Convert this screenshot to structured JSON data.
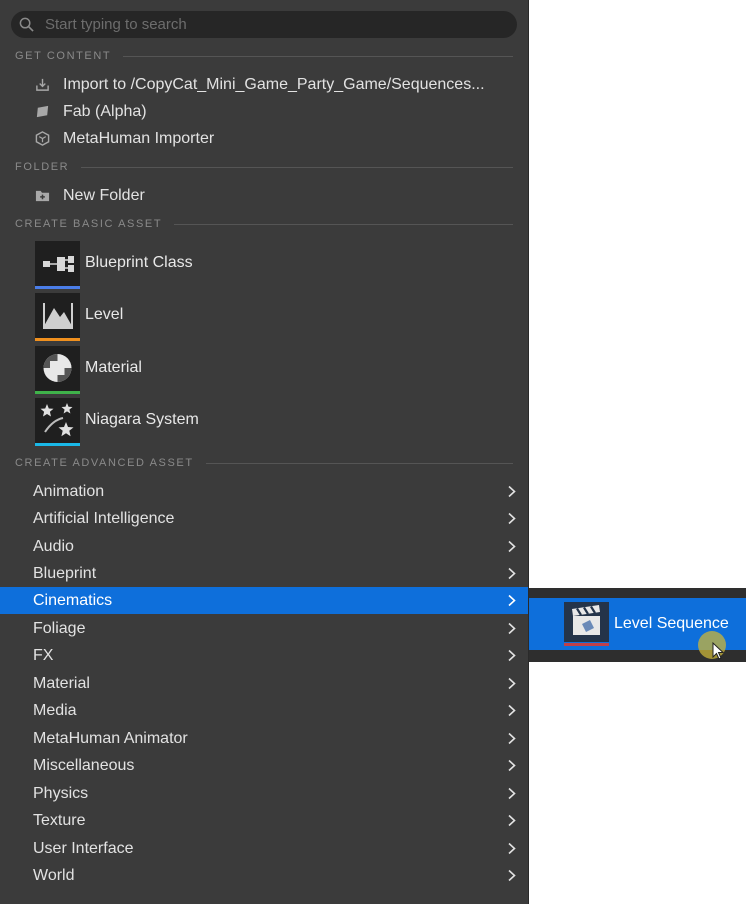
{
  "search": {
    "placeholder": "Start typing to search",
    "icon": "search-icon"
  },
  "get_content": {
    "header": "GET CONTENT",
    "items": [
      {
        "label": "Import to /CopyCat_Mini_Game_Party_Game/Sequences...",
        "icon": "import-icon"
      },
      {
        "label": "Fab (Alpha)",
        "icon": "fab-icon"
      },
      {
        "label": "MetaHuman Importer",
        "icon": "metahuman-icon"
      }
    ]
  },
  "folder": {
    "header": "FOLDER",
    "items": [
      {
        "label": "New Folder",
        "icon": "new-folder-icon"
      }
    ]
  },
  "basic_assets": {
    "header": "CREATE BASIC ASSET",
    "items": [
      {
        "label": "Blueprint Class",
        "icon": "blueprint-class-icon",
        "color": "#4a7de8"
      },
      {
        "label": "Level",
        "icon": "level-icon",
        "color": "#f0901e"
      },
      {
        "label": "Material",
        "icon": "material-icon",
        "color": "#3fb24a"
      },
      {
        "label": "Niagara System",
        "icon": "niagara-system-icon",
        "color": "#1ab8e8"
      }
    ]
  },
  "advanced_assets": {
    "header": "CREATE ADVANCED ASSET",
    "items": [
      {
        "label": "Animation"
      },
      {
        "label": "Artificial Intelligence"
      },
      {
        "label": "Audio"
      },
      {
        "label": "Blueprint"
      },
      {
        "label": "Cinematics",
        "selected": true
      },
      {
        "label": "Foliage"
      },
      {
        "label": "FX"
      },
      {
        "label": "Material"
      },
      {
        "label": "Media"
      },
      {
        "label": "MetaHuman Animator"
      },
      {
        "label": "Miscellaneous"
      },
      {
        "label": "Physics"
      },
      {
        "label": "Texture"
      },
      {
        "label": "User Interface"
      },
      {
        "label": "World"
      }
    ]
  },
  "submenu": {
    "items": [
      {
        "label": "Level Sequence",
        "icon": "level-sequence-icon",
        "color": "#c0404a"
      }
    ]
  },
  "colors": {
    "menu_bg": "#3b3b3b",
    "selection": "#0e6fdb",
    "section_text": "#8a8a8a"
  }
}
